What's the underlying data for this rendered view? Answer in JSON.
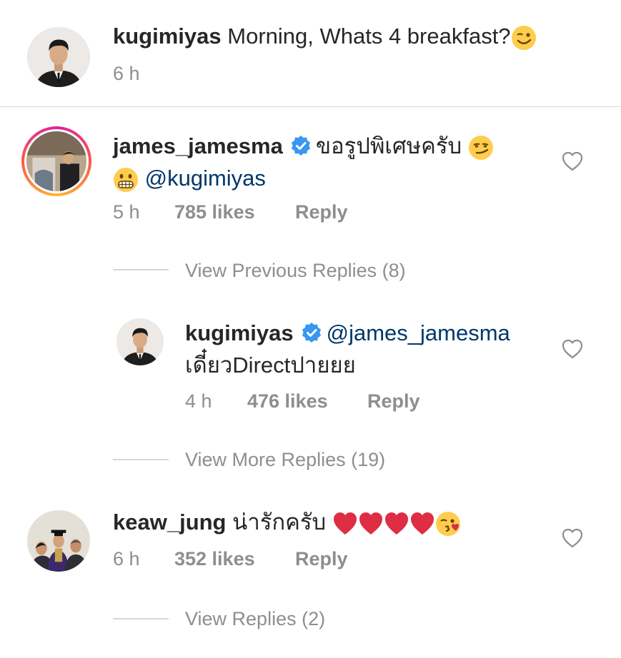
{
  "caption": {
    "username": "kugimiyas",
    "text": "Morning, Whats 4 breakfast?",
    "emoji": "winking-face",
    "time": "6 h"
  },
  "comments": [
    {
      "username": "james_jamesma",
      "verified": true,
      "text": "ขอรูปพิเศษครับ",
      "emoji1": "smirking-face",
      "emoji2": "grimacing-face",
      "mention": "@kugimiyas",
      "time": "5 h",
      "likes": "785 likes",
      "reply_label": "Reply",
      "view_replies": "View Previous Replies (8)",
      "reply": {
        "username": "kugimiyas",
        "verified": true,
        "mention": "@james_jamesma",
        "text": "เดี๋ยวDirectปายยย",
        "time": "4 h",
        "likes": "476 likes",
        "reply_label": "Reply"
      },
      "view_more": "View More Replies (19)"
    },
    {
      "username": "keaw_jung",
      "text": "น่ารักครับ",
      "emojis": [
        "red-heart",
        "red-heart",
        "red-heart",
        "red-heart",
        "face-blowing-kiss"
      ],
      "time": "6 h",
      "likes": "352 likes",
      "reply_label": "Reply",
      "view_replies": "View Replies (2)"
    }
  ],
  "colors": {
    "text": "#262626",
    "meta": "#8e8e8e",
    "mention": "#00376b",
    "verified": "#3897f0",
    "heart": "#ed1c24"
  }
}
